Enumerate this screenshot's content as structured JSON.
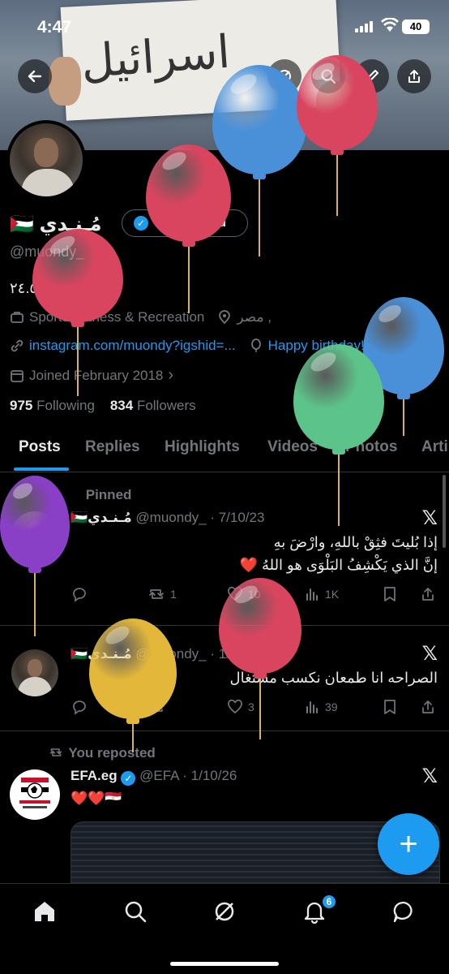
{
  "status_bar": {
    "time": "4:47",
    "battery": "40"
  },
  "banner": {
    "sign_text": "اسرائيل"
  },
  "profile": {
    "name": "مُـنـدي",
    "flag": "🇵🇸",
    "verify_label": "Get verified",
    "handle": "@muondy_",
    "bio": "٢٤.٥",
    "category": "Sports, Fitness & Recreation",
    "location": "مصر ,",
    "link": "instagram.com/muondy?igshid=...",
    "birthday": "Happy birthday!",
    "joined": "Joined February 2018",
    "following_count": "975",
    "following_label": "Following",
    "followers_count": "834",
    "followers_label": "Followers"
  },
  "tabs": [
    "Posts",
    "Replies",
    "Highlights",
    "Videos",
    "Photos",
    "Arti"
  ],
  "tweets": [
    {
      "pinned_label": "Pinned",
      "name": "مُـنـدي",
      "flag": "🇵🇸",
      "handle_date": "@muondy_ · 7/10/23",
      "line1": "إذا بُليتَ فثِقْ باللهِ، وارْضَ بهِ",
      "line2": "إنَّ الذي يَكْشِفُ البَلْوَى هو اللهُ ❤️",
      "replies": "",
      "reposts": "1",
      "likes": "10",
      "views": "1K"
    },
    {
      "name": "مُـنـدي",
      "flag": "🇵🇸",
      "handle_date": "@muondy_ · 1/13/26",
      "line1": "الصراحه انا طمعان نكسب مستغال",
      "replies": "",
      "reposts": "",
      "likes": "3",
      "views": "39"
    },
    {
      "repost_label": "You reposted",
      "name": "EFA.eg",
      "handle_date": "@EFA · 1/10/26",
      "line1": "❤️❤️🇪🇬"
    }
  ],
  "notifications_count": "6",
  "colors": {
    "accent": "#1d9bf0",
    "background": "#000000",
    "muted": "#71767b",
    "balloon_red": "#d9455f",
    "balloon_blue": "#4a90d9",
    "balloon_green": "#5cc48a",
    "balloon_purple": "#8a3fc7",
    "balloon_yellow": "#e3b83a"
  },
  "icons": [
    "back-arrow-icon",
    "search-icon",
    "share-icon",
    "home-icon",
    "grok-icon",
    "bell-icon",
    "messages-icon",
    "x-logo-icon",
    "reply-icon",
    "repost-icon",
    "like-icon",
    "views-icon",
    "bookmark-icon"
  ]
}
